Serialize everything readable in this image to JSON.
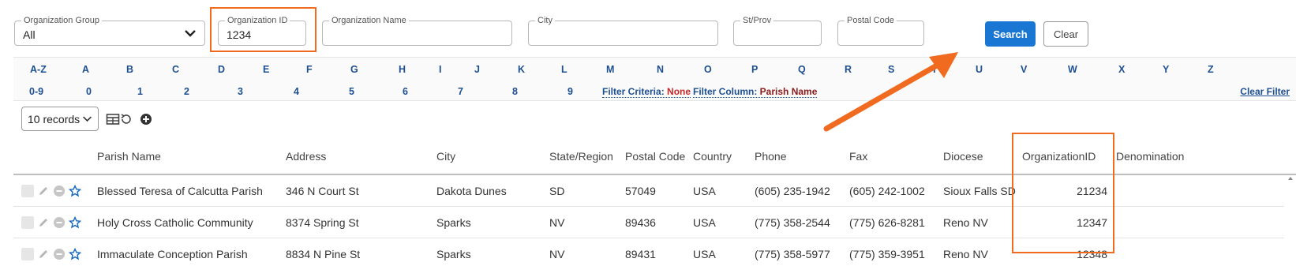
{
  "filters": {
    "org_group": {
      "label": "Organization Group",
      "value": "All"
    },
    "org_id": {
      "label": "Organization ID",
      "value": "1234"
    },
    "org_name": {
      "label": "Organization Name",
      "value": ""
    },
    "city": {
      "label": "City",
      "value": ""
    },
    "st_prov": {
      "label": "St/Prov",
      "value": ""
    },
    "postal": {
      "label": "Postal Code",
      "value": ""
    },
    "search_label": "Search",
    "clear_label": "Clear"
  },
  "alpha_row": [
    "A-Z",
    "A",
    "B",
    "C",
    "D",
    "E",
    "F",
    "G",
    "H",
    "I",
    "J",
    "K",
    "L",
    "M",
    "N",
    "O",
    "P",
    "Q",
    "R",
    "S",
    "T",
    "U",
    "V",
    "W",
    "X",
    "Y",
    "Z"
  ],
  "digit_row": [
    "0-9",
    "0",
    "1",
    "2",
    "3",
    "4",
    "5",
    "6",
    "7",
    "8",
    "9"
  ],
  "filter_info": {
    "criteria_label": "Filter Criteria:",
    "criteria_value": "None",
    "column_label": "Filter Column:",
    "column_value": "Parish Name",
    "clear_filter": "Clear Filter"
  },
  "toolbar": {
    "records": "10 records"
  },
  "table": {
    "headers": [
      "Parish Name",
      "Address",
      "City",
      "State/Region",
      "Postal Code",
      "Country",
      "Phone",
      "Fax",
      "Diocese",
      "OrganizationID",
      "Denomination"
    ],
    "rows": [
      [
        "Blessed Teresa of Calcutta Parish",
        "346 N Court St",
        "Dakota Dunes",
        "SD",
        "57049",
        "USA",
        "(605) 235-1942",
        "(605) 242-1002",
        "Sioux Falls SD",
        "21234",
        ""
      ],
      [
        "Holy Cross Catholic Community",
        "8374 Spring St",
        "Sparks",
        "NV",
        "89436",
        "USA",
        "(775) 358-2544",
        "(775) 626-8281",
        "Reno NV",
        "12347",
        ""
      ],
      [
        "Immaculate Conception Parish",
        "8834 N Pine St",
        "Sparks",
        "NV",
        "89431",
        "USA",
        "(775) 358-5977",
        "(775) 359-3951",
        "Reno NV",
        "12348",
        ""
      ]
    ]
  },
  "colors": {
    "accent": "#1976d2",
    "highlight": "#f06a1f",
    "link": "#1d4f91"
  }
}
